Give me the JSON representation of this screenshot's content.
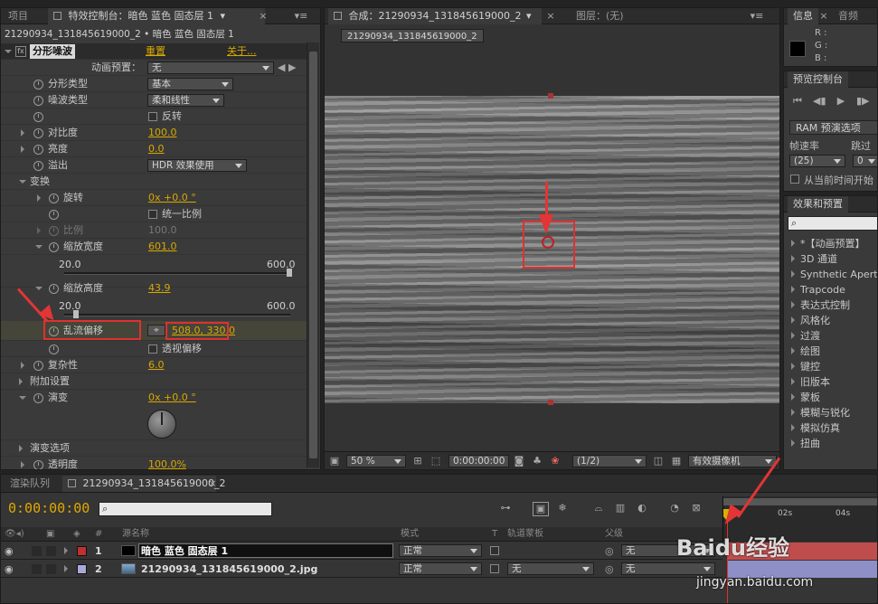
{
  "project_tab": "项目",
  "effect_controls": {
    "tab_title": "特效控制台：暗色 蓝色 固态层 1",
    "breadcrumb": "21290934_131845619000_2 • 暗色 蓝色 固态层 1",
    "effect_name": "分形噪波",
    "reset_label": "重置",
    "about_label": "关于...",
    "preset_label": "动画预置：",
    "preset_value": "无",
    "rows": {
      "fractal_type": {
        "label": "分形类型",
        "value": "基本"
      },
      "noise_type": {
        "label": "噪波类型",
        "value": "柔和线性"
      },
      "invert": {
        "label": "反转"
      },
      "contrast": {
        "label": "对比度",
        "value": "100.0"
      },
      "brightness": {
        "label": "亮度",
        "value": "0.0"
      },
      "overflow": {
        "label": "溢出",
        "value": "HDR 效果使用"
      },
      "transform": {
        "label": "变换"
      },
      "rotation": {
        "label": "旋转",
        "value": "0x +0.0 °"
      },
      "uniform_scale": {
        "label": "统一比例"
      },
      "scale": {
        "label": "比例",
        "value": "100.0"
      },
      "scale_width": {
        "label": "缩放宽度",
        "value": "601.0",
        "min": "20.0",
        "max": "600.0"
      },
      "scale_height": {
        "label": "缩放高度",
        "value": "43.9",
        "min": "20.0",
        "max": "600.0"
      },
      "turbulence_offset": {
        "label": "乱流偏移",
        "value": "508.0, 330.0"
      },
      "perspective_offset": {
        "label": "透视偏移"
      },
      "complexity": {
        "label": "复杂性",
        "value": "6.0"
      },
      "sub_settings": {
        "label": "附加设置"
      },
      "evolution": {
        "label": "演变",
        "value": "0x +0.0 °"
      },
      "evolution_options": {
        "label": "演变选项"
      },
      "opacity": {
        "label": "透明度",
        "value": "100.0%"
      }
    },
    "scale_width_level": 1.0,
    "scale_height_level": 0.041
  },
  "composition": {
    "tab_title": "合成：21290934_131845619000_2",
    "layer_tab": "图层：(无)",
    "comp_chip": "21290934_131845619000_2",
    "zoom": "50 %",
    "timecode": "0:00:00:00",
    "resolution": "(1/2)",
    "camera": "有效摄像机"
  },
  "info": {
    "tab": "信息",
    "audio_tab": "音频",
    "r": "R :",
    "g": "G :",
    "b": "B :"
  },
  "preview": {
    "tab": "预览控制台",
    "ram_label": "RAM 预演选项",
    "frame_rate_label": "帧速率",
    "skip_label": "跳过",
    "frame_rate_value": "(25)",
    "skip_value": "0",
    "from_current_label": "从当前时间开始"
  },
  "effects_presets": {
    "tab": "效果和预置",
    "items": [
      "*【动画预置】",
      "3D 通道",
      "Synthetic Aperture",
      "Trapcode",
      "表达式控制",
      "风格化",
      "过渡",
      "绘图",
      "键控",
      "旧版本",
      "蒙板",
      "模糊与锐化",
      "模拟仿真",
      "扭曲"
    ]
  },
  "timeline": {
    "render_tab": "渲染队列",
    "comp_tab": "21290934_131845619000_2",
    "timecode": "0:00:00:00",
    "col_source": "源名称",
    "col_mode": "模式",
    "col_t": "T",
    "col_trkmat": "轨道蒙板",
    "col_parent": "父级",
    "ruler": [
      "0s",
      "02s",
      "04s"
    ],
    "layers": [
      {
        "num": "1",
        "name": "暗色 蓝色 固态层 1",
        "mode": "正常",
        "trkmat": "",
        "parent": "无",
        "color": "#c03030"
      },
      {
        "num": "2",
        "name": "21290934_131845619000_2.jpg",
        "mode": "正常",
        "trkmat": "无",
        "parent": "无",
        "color": "#a9a9d8"
      }
    ]
  },
  "watermark": {
    "brand": "Baidu经验",
    "url": "jingyan.baidu.com"
  }
}
